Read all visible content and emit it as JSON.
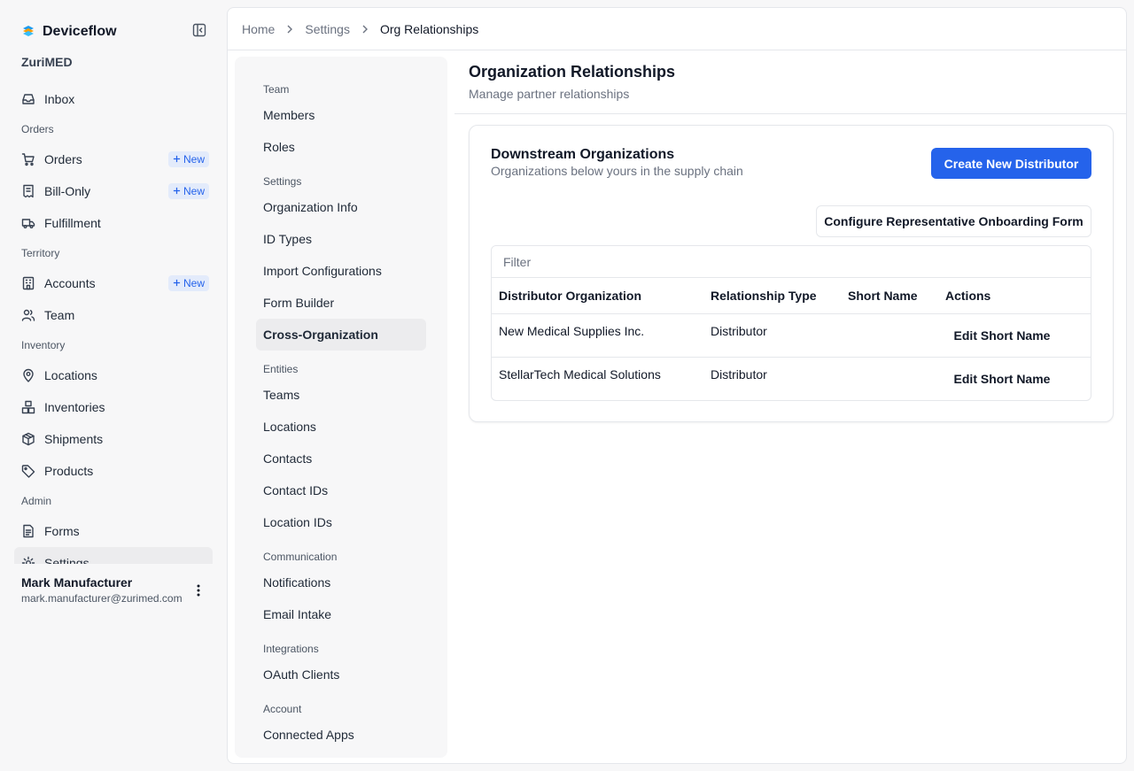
{
  "app": {
    "name": "Deviceflow",
    "org": "ZuriMED"
  },
  "sidebar": {
    "items": [
      {
        "type": "item",
        "name": "sidebar-item-inbox",
        "icon": "inbox-icon",
        "label": "Inbox"
      },
      {
        "type": "group",
        "label": "Orders"
      },
      {
        "type": "item",
        "name": "sidebar-item-orders",
        "icon": "cart-icon",
        "label": "Orders",
        "badge": "New"
      },
      {
        "type": "item",
        "name": "sidebar-item-bill-only",
        "icon": "receipt-icon",
        "label": "Bill-Only",
        "badge": "New"
      },
      {
        "type": "item",
        "name": "sidebar-item-fulfillment",
        "icon": "truck-icon",
        "label": "Fulfillment"
      },
      {
        "type": "group",
        "label": "Territory"
      },
      {
        "type": "item",
        "name": "sidebar-item-accounts",
        "icon": "building-icon",
        "label": "Accounts",
        "badge": "New"
      },
      {
        "type": "item",
        "name": "sidebar-item-team",
        "icon": "users-icon",
        "label": "Team"
      },
      {
        "type": "group",
        "label": "Inventory"
      },
      {
        "type": "item",
        "name": "sidebar-item-locations",
        "icon": "map-pin-icon",
        "label": "Locations"
      },
      {
        "type": "item",
        "name": "sidebar-item-inventories",
        "icon": "boxes-icon",
        "label": "Inventories"
      },
      {
        "type": "item",
        "name": "sidebar-item-shipments",
        "icon": "package-icon",
        "label": "Shipments"
      },
      {
        "type": "item",
        "name": "sidebar-item-products",
        "icon": "tag-icon",
        "label": "Products"
      },
      {
        "type": "group",
        "label": "Admin"
      },
      {
        "type": "item",
        "name": "sidebar-item-forms",
        "icon": "form-icon",
        "label": "Forms"
      },
      {
        "type": "item",
        "name": "sidebar-item-settings",
        "icon": "gear-icon",
        "label": "Settings",
        "active": true
      }
    ]
  },
  "user": {
    "name": "Mark Manufacturer",
    "email": "mark.manufacturer@zurimed.com"
  },
  "breadcrumb": {
    "home": "Home",
    "settings": "Settings",
    "current": "Org Relationships"
  },
  "settings_menu": [
    {
      "type": "group",
      "label": "Team"
    },
    {
      "type": "item",
      "label": "Members"
    },
    {
      "type": "item",
      "label": "Roles"
    },
    {
      "type": "group",
      "label": "Settings"
    },
    {
      "type": "item",
      "label": "Organization Info"
    },
    {
      "type": "item",
      "label": "ID Types"
    },
    {
      "type": "item",
      "label": "Import Configurations"
    },
    {
      "type": "item",
      "label": "Form Builder"
    },
    {
      "type": "item",
      "label": "Cross-Organization",
      "active": true
    },
    {
      "type": "group",
      "label": "Entities"
    },
    {
      "type": "item",
      "label": "Teams"
    },
    {
      "type": "item",
      "label": "Locations"
    },
    {
      "type": "item",
      "label": "Contacts"
    },
    {
      "type": "item",
      "label": "Contact IDs"
    },
    {
      "type": "item",
      "label": "Location IDs"
    },
    {
      "type": "group",
      "label": "Communication"
    },
    {
      "type": "item",
      "label": "Notifications"
    },
    {
      "type": "item",
      "label": "Email Intake"
    },
    {
      "type": "group",
      "label": "Integrations"
    },
    {
      "type": "item",
      "label": "OAuth Clients"
    },
    {
      "type": "group",
      "label": "Account"
    },
    {
      "type": "item",
      "label": "Connected Apps"
    }
  ],
  "page": {
    "title": "Organization Relationships",
    "subtitle": "Manage partner relationships"
  },
  "card": {
    "title": "Downstream Organizations",
    "subtitle": "Organizations below yours in the supply chain",
    "create_button": "Create New Distributor",
    "configure_button": "Configure Representative Onboarding Form",
    "filter_placeholder": "Filter",
    "columns": [
      "Distributor Organization",
      "Relationship Type",
      "Short Name",
      "Actions"
    ],
    "rows": [
      {
        "organization": "New Medical Supplies Inc.",
        "relationship": "Distributor",
        "short_name": "",
        "action": "Edit Short Name"
      },
      {
        "organization": "StellarTech Medical Solutions",
        "relationship": "Distributor",
        "short_name": "",
        "action": "Edit Short Name"
      }
    ]
  },
  "colors": {
    "accent": "#2563eb",
    "badge_bg": "#e3ebfb",
    "logo_blue": "#1d9bf0",
    "logo_orange": "#f59e0b"
  }
}
